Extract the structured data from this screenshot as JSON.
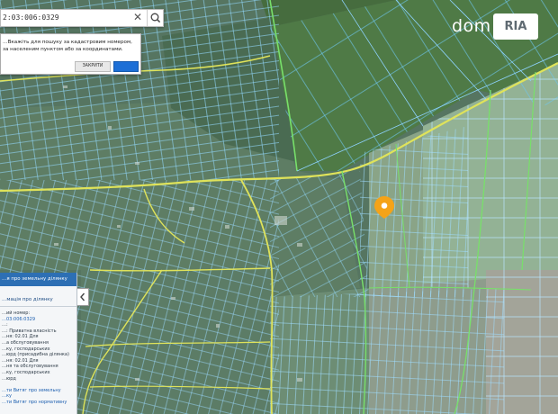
{
  "search": {
    "value": "2:03:006:0329",
    "clear_glyph": "✕",
    "icon": "search-icon"
  },
  "hint": {
    "text": "…Вкажіть для пошуку за кадастровим номером, за населеним пунктом або за координатами.",
    "close_label": "ЗАКРИТИ",
    "confirm_label": ""
  },
  "panel": {
    "header": "…я про земельну ділянку",
    "subheader": "…мація про ділянку",
    "lines": [
      {
        "text": "…ий номер:",
        "link": false
      },
      {
        "text": "…03:006:0329",
        "link": true
      },
      {
        "text": "…:",
        "link": false
      },
      {
        "text": "…: Приватна власність",
        "link": false
      },
      {
        "text": "…ня: 02.01 Для",
        "link": false
      },
      {
        "text": "…а обслуговування",
        "link": false
      },
      {
        "text": "…ку, господарських",
        "link": false
      },
      {
        "text": "…юрд (присадибна ділянка)",
        "link": false
      },
      {
        "text": "…ня: 02.01 Для",
        "link": false
      },
      {
        "text": "…ня та обслуговування",
        "link": false
      },
      {
        "text": "…ку, господарських",
        "link": false
      },
      {
        "text": "…юрд",
        "link": false
      },
      {
        "text": "",
        "link": false
      },
      {
        "text": "…ти Витяг про земельну",
        "link": true
      },
      {
        "text": "…ку",
        "link": true
      },
      {
        "text": "…ти Витяг про нормативну",
        "link": true
      }
    ],
    "toggle_icon": "chevron-left-icon"
  },
  "map": {
    "marker_icon": "location-pin-icon",
    "marker_color": "#f5a318",
    "parcel_line_color": "#7fd0ff",
    "road_color": "#e4e85a",
    "boundary_color": "#78e06a"
  },
  "logo": {
    "text": "dom",
    "badge_text": "RIA"
  }
}
